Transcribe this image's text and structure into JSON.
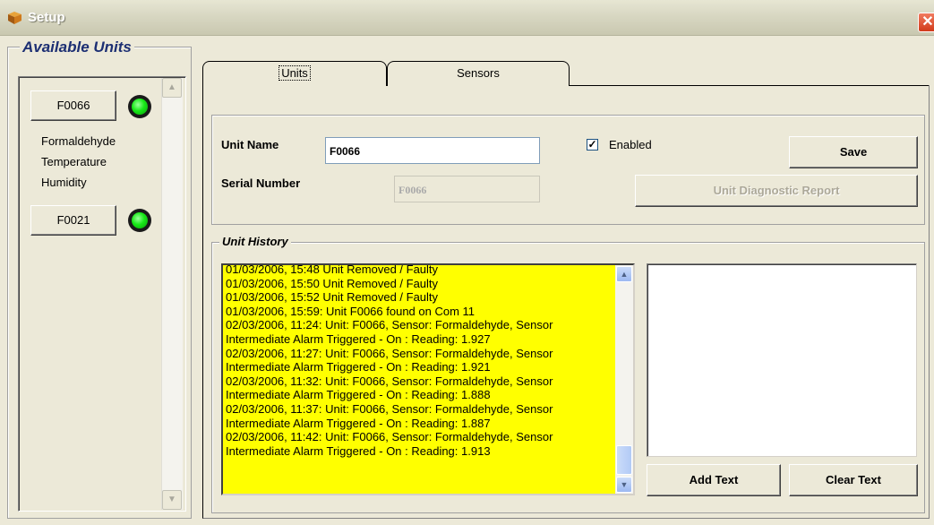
{
  "window": {
    "title": "Setup",
    "icon": "setup-box-icon",
    "close_glyph": "✕"
  },
  "available_units": {
    "legend": "Available Units",
    "units": [
      {
        "label": "F0066",
        "status_color": "#17e817",
        "sensors": [
          "Formaldehyde",
          "Temperature",
          "Humidity"
        ]
      },
      {
        "label": "F0021",
        "status_color": "#17e817",
        "sensors": []
      }
    ]
  },
  "tabs": [
    {
      "label": "Units",
      "active": true
    },
    {
      "label": "Sensors",
      "active": false
    }
  ],
  "unit_form": {
    "unit_name_label": "Unit Name",
    "unit_name_value": "F0066",
    "serial_number_label": "Serial Number",
    "serial_number_value": "F0066",
    "enabled_label": "Enabled",
    "enabled_checked": true,
    "save_label": "Save",
    "diagnostic_label": "Unit Diagnostic Report"
  },
  "history": {
    "legend": "Unit History",
    "lines": [
      "01/03/2006, 15:48 Unit Removed / Faulty",
      "01/03/2006, 15:50 Unit Removed / Faulty",
      "01/03/2006, 15:52 Unit Removed / Faulty",
      "01/03/2006, 15:59: Unit F0066 found on Com 11",
      "02/03/2006, 11:24: Unit: F0066, Sensor: Formaldehyde, Sensor",
      "Intermediate Alarm Triggered - On : Reading: 1.927",
      "02/03/2006, 11:27: Unit: F0066, Sensor: Formaldehyde, Sensor",
      "Intermediate Alarm Triggered - On : Reading: 1.921",
      "02/03/2006, 11:32: Unit: F0066, Sensor: Formaldehyde, Sensor",
      "Intermediate Alarm Triggered - On : Reading: 1.888",
      "02/03/2006, 11:37: Unit: F0066, Sensor: Formaldehyde, Sensor",
      "Intermediate Alarm Triggered - On : Reading: 1.887",
      "02/03/2006, 11:42: Unit: F0066, Sensor: Formaldehyde, Sensor",
      "Intermediate Alarm Triggered - On : Reading: 1.913"
    ],
    "log_background": "#ffff00",
    "add_text_label": "Add Text",
    "clear_text_label": "Clear Text"
  }
}
